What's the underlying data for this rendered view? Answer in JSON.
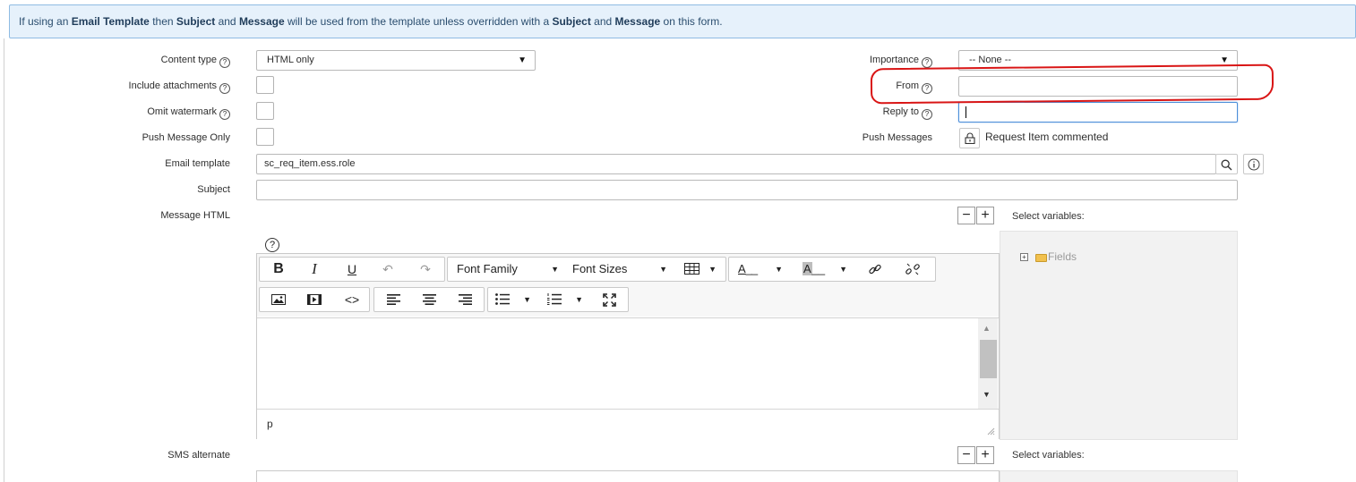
{
  "banner": {
    "t1": "If using an ",
    "b1": "Email Template",
    "t2": " then ",
    "b2": "Subject",
    "t3": " and ",
    "b3": "Message",
    "t4": " will be used from the template unless overridden with a ",
    "b4": "Subject",
    "t5": " and ",
    "b5": "Message",
    "t6": " on this form."
  },
  "form": {
    "content_type": {
      "label": "Content type",
      "value": "HTML only"
    },
    "include_attachments": {
      "label": "Include attachments"
    },
    "omit_watermark": {
      "label": "Omit watermark"
    },
    "push_message_only": {
      "label": "Push Message Only"
    },
    "email_template": {
      "label": "Email template",
      "value": "sc_req_item.ess.role"
    },
    "subject": {
      "label": "Subject",
      "value": ""
    },
    "message_html": {
      "label": "Message HTML"
    },
    "sms_alternate": {
      "label": "SMS alternate"
    },
    "importance": {
      "label": "Importance",
      "value": "-- None --"
    },
    "from": {
      "label": "From",
      "value": ""
    },
    "reply_to": {
      "label": "Reply to",
      "value": ""
    },
    "push_messages": {
      "label": "Push Messages",
      "value": "Request Item commented"
    }
  },
  "help_glyph": "?",
  "editor": {
    "toolbar": {
      "bold": "B",
      "italic": "I",
      "underline": "U",
      "font_family": "Font Family",
      "font_sizes": "Font Sizes",
      "text_color": "A",
      "bg_color": "A"
    },
    "status_path": "p"
  },
  "select_variables": {
    "label": "Select variables:",
    "tree": [
      {
        "label": "Fields"
      }
    ]
  },
  "icons": {
    "search": "search-icon",
    "info": "info-icon",
    "lock": "lock-icon",
    "help": "help-icon"
  },
  "colors": {
    "banner_bg": "#e6f1fb",
    "banner_border": "#8fbbe3",
    "focus_border": "#4c8ed9",
    "annotation": "#d91515"
  }
}
